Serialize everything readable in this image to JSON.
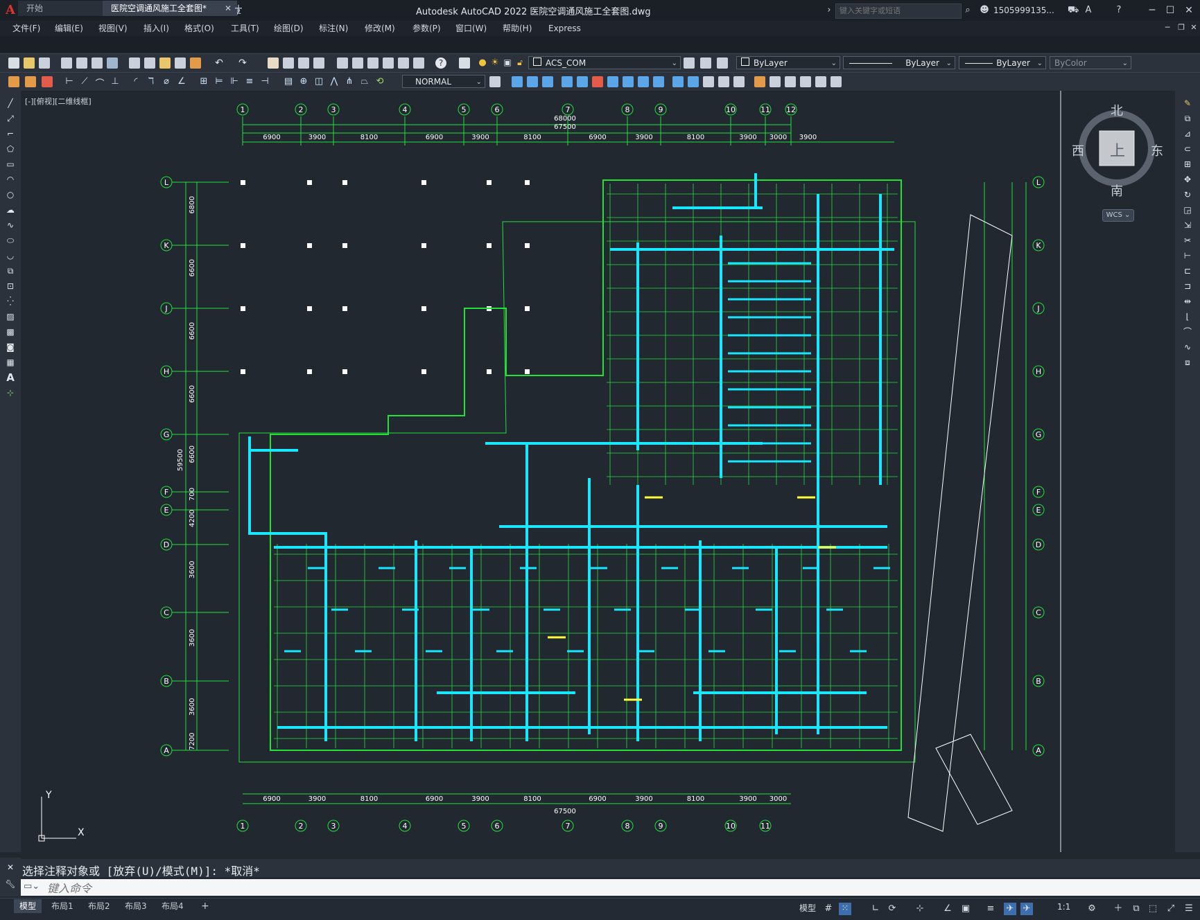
{
  "titlebar": {
    "share_label": "共享",
    "window_title": "Autodesk AutoCAD 2022    医院空调通风施工全套图.dwg",
    "search_placeholder": "键入关键字或短语",
    "user_name": "1505999135..."
  },
  "menu": [
    "文件(F)",
    "编辑(E)",
    "视图(V)",
    "插入(I)",
    "格式(O)",
    "工具(T)",
    "绘图(D)",
    "标注(N)",
    "修改(M)",
    "参数(P)",
    "窗口(W)",
    "帮助(H)",
    "Express"
  ],
  "tabs": {
    "start": "开始",
    "drawing": "医院空调通风施工全套图*"
  },
  "toolbar": {
    "layer_combo": "ACS_COM",
    "color_combo": "ByLayer",
    "linetype_combo": "ByLayer",
    "lineweight_combo": "ByLayer",
    "plotstyle_combo": "ByColor",
    "dimstyle_combo": "NORMAL"
  },
  "viewport": {
    "label": "[-][俯视][二维线框]"
  },
  "viewcube": {
    "north": "北",
    "south": "南",
    "east": "东",
    "west": "西",
    "top": "上",
    "wcs": "WCS"
  },
  "drawing": {
    "top_axes": [
      "1",
      "2",
      "3",
      "4",
      "5",
      "6",
      "7",
      "8",
      "9",
      "10",
      "11",
      "12"
    ],
    "bottom_axes": [
      "1",
      "2",
      "3",
      "4",
      "5",
      "6",
      "7",
      "8",
      "9",
      "10",
      "11"
    ],
    "row_axes": [
      "L",
      "K",
      "J",
      "H",
      "G",
      "F",
      "E",
      "D",
      "C",
      "B",
      "A"
    ],
    "total_dim": "67500",
    "overall_dim": "68000",
    "span_dims": [
      "6900",
      "3900",
      "8100",
      "6900",
      "3900",
      "8100",
      "6900",
      "3900",
      "8100",
      "3900",
      "3000",
      "3900"
    ],
    "side_total": "59500",
    "side_spans": [
      "6800",
      "6600",
      "6600",
      "6600",
      "6600",
      "700",
      "4200",
      "3600",
      "3600",
      "3600",
      "7200"
    ],
    "ucs_x": "X",
    "ucs_y": "Y"
  },
  "command": {
    "history": "选择注释对象或 [放弃(U)/模式(M)]: *取消*",
    "placeholder": "键入命令"
  },
  "statusbar": {
    "layouts": [
      "模型",
      "布局1",
      "布局2",
      "布局3",
      "布局4"
    ],
    "model_label": "模型",
    "scale": "1:1"
  }
}
